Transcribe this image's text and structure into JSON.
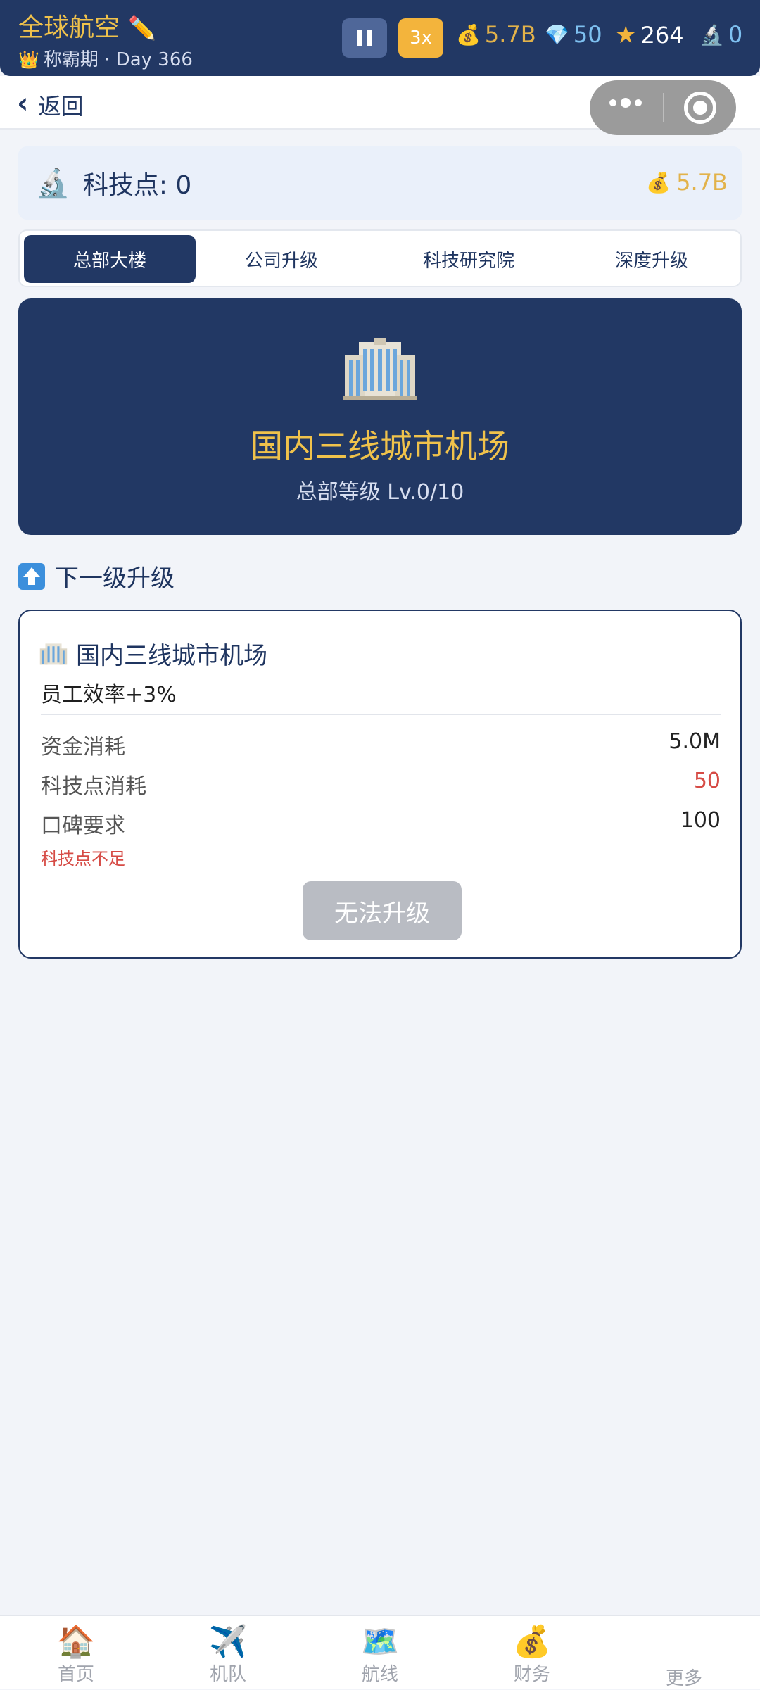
{
  "topbar": {
    "title": "全球航空",
    "pencil_icon": "✏️",
    "phase_icon": "👑",
    "phase": "称霸期 · Day 366",
    "speed": "3x",
    "money": "5.7B",
    "diamonds": "50",
    "stars": "264",
    "tech": "0",
    "money_icon": "💰",
    "diamond_icon": "💎",
    "star_icon": "★",
    "tech_icon": "🔬"
  },
  "nav": {
    "back_label": "返回",
    "back_icon": "‹"
  },
  "tech_header": {
    "label": "科技点: 0",
    "money": "5.7B",
    "tech_icon": "🔬",
    "money_icon": "💰"
  },
  "tabs": [
    {
      "label": "总部大楼",
      "active": true
    },
    {
      "label": "公司升级",
      "active": false
    },
    {
      "label": "科技研究院",
      "active": false
    },
    {
      "label": "深度升级",
      "active": false
    }
  ],
  "hero": {
    "title": "国内三线城市机场",
    "subtitle": "总部等级 Lv.0/10"
  },
  "section": {
    "title": "下一级升级"
  },
  "upgrade": {
    "title": "国内三线城市机场",
    "effect": "员工效率+3%",
    "rows": [
      {
        "label": "资金消耗",
        "value": "5.0M",
        "highlight": false
      },
      {
        "label": "科技点消耗",
        "value": "50",
        "highlight": true
      },
      {
        "label": "口碑要求",
        "value": "100",
        "highlight": false
      }
    ],
    "warning": "科技点不足",
    "button": "无法升级"
  },
  "bottom_nav": [
    {
      "label": "首页",
      "icon": "🏠"
    },
    {
      "label": "机队",
      "icon": "✈️"
    },
    {
      "label": "航线",
      "icon": "🗺️"
    },
    {
      "label": "财务",
      "icon": "💰"
    },
    {
      "label": "更多",
      "icon": ""
    }
  ],
  "colors": {
    "primary": "#223864",
    "accent": "#f0c24b",
    "warning": "#d64b45",
    "background": "#f2f4f9"
  }
}
